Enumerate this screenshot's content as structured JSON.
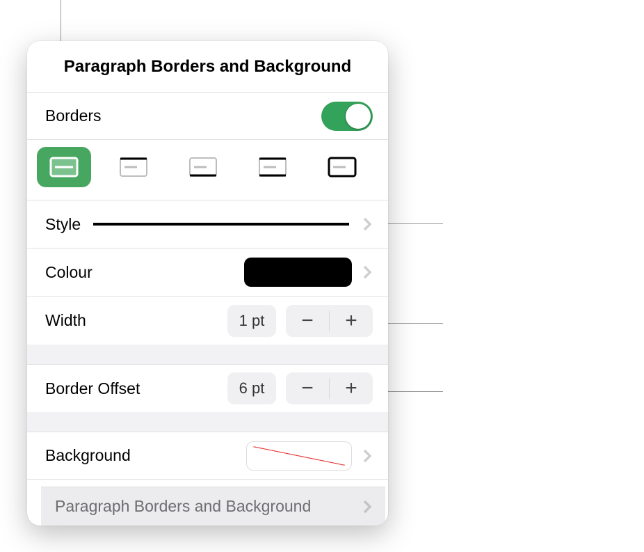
{
  "header": {
    "title": "Paragraph Borders and Background"
  },
  "borders_row": {
    "label": "Borders",
    "on": true
  },
  "style_row": {
    "label": "Style"
  },
  "colour_row": {
    "label": "Colour",
    "colour": "#000000"
  },
  "width_row": {
    "label": "Width",
    "value": "1 pt"
  },
  "offset_row": {
    "label": "Border Offset",
    "value": "6 pt"
  },
  "background_row": {
    "label": "Background"
  },
  "under_menu": {
    "label": "Paragraph Borders and Background"
  },
  "stepper": {
    "minus": "−",
    "plus": "+"
  }
}
